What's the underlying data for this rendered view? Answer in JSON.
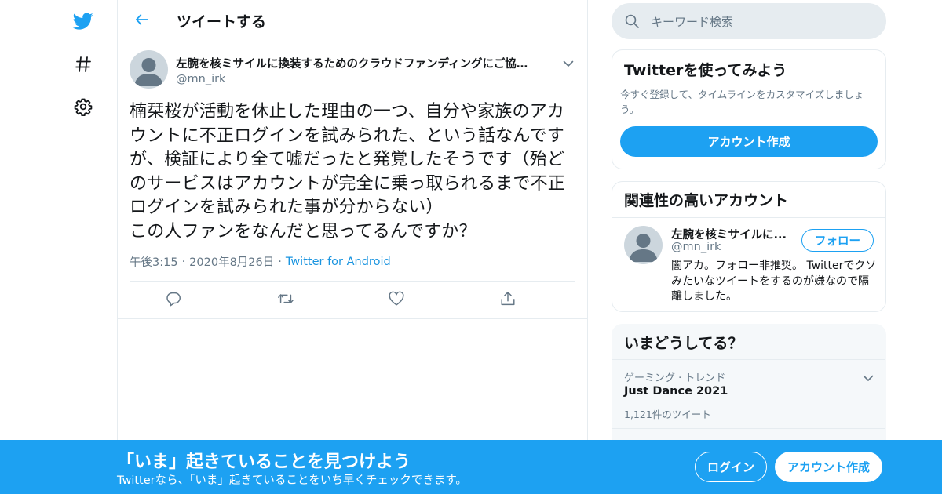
{
  "colors": {
    "accent": "#1da1f2",
    "text": "#14171a",
    "muted": "#657786",
    "border": "#e6ecf0"
  },
  "nav": {
    "icons": [
      "twitter-bird-icon",
      "hashtag-icon",
      "gear-icon"
    ]
  },
  "header": {
    "title": "ツイートする",
    "back_icon": "arrow-left-icon"
  },
  "tweet": {
    "display_name": "左腕を核ミサイルに換装するためのクラウドファンディングにご協…",
    "handle": "@mn_irk",
    "text": "楠栞桜が活動を休止した理由の一つ、自分や家族のアカウントに不正ログインを試みられた、という話なんですが、検証により全て嘘だったと発覚したそうです（殆どのサービスはアカウントが完全に乗っ取られるまで不正ログインを試みられた事が分からない）\nこの人ファンをなんだと思ってるんですか？",
    "time": "午後3:15",
    "date": "2020年8月26日",
    "source": "Twitter for Android",
    "actions": [
      "reply-icon",
      "retweet-icon",
      "like-icon",
      "share-icon"
    ]
  },
  "search": {
    "placeholder": "キーワード検索"
  },
  "signup_card": {
    "title": "Twitterを使ってみよう",
    "desc": "今すぐ登録して、タイムラインをカスタマイズしましょう。",
    "button": "アカウント作成"
  },
  "related": {
    "title": "関連性の高いアカウント",
    "name": "左腕を核ミサイルに...",
    "handle": "@mn_irk",
    "follow": "フォロー",
    "bio": "闇アカ。フォロー非推奨。 Twitterでクソみたいなツイートをするのが嫌なので隔離しました。"
  },
  "trends": {
    "title": "いまどうしてる？",
    "items": [
      {
        "context": "ゲーミング · トレンド",
        "name": "Just Dance 2021",
        "count": "1,121件のツイート"
      }
    ]
  },
  "bottom_bar": {
    "title": "「いま」起きていることを見つけよう",
    "subtitle": "Twitterなら、「いま」起きていることをいち早くチェックできます。",
    "login": "ログイン",
    "signup": "アカウント作成"
  }
}
